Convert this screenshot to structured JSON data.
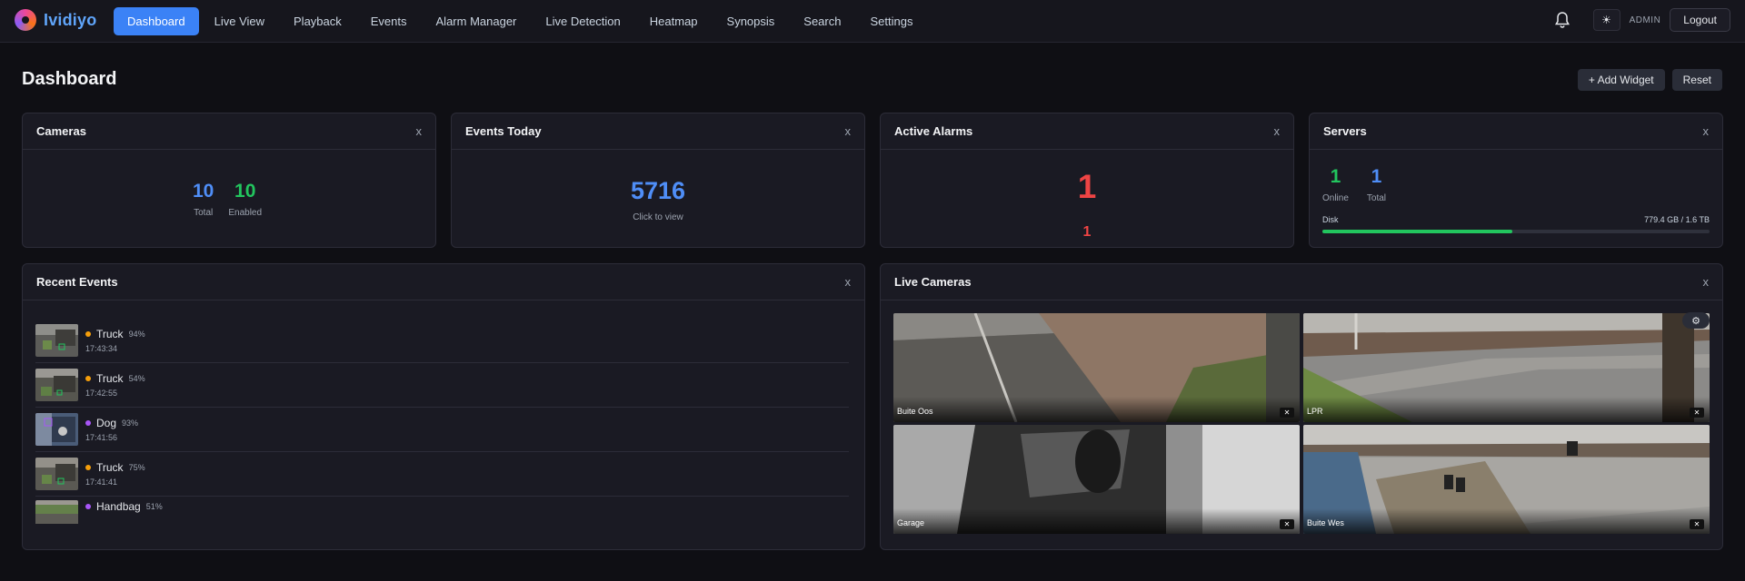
{
  "app": {
    "name": "Ividiyo"
  },
  "nav": {
    "items": [
      {
        "label": "Dashboard",
        "active": true
      },
      {
        "label": "Live View"
      },
      {
        "label": "Playback"
      },
      {
        "label": "Events"
      },
      {
        "label": "Alarm Manager"
      },
      {
        "label": "Live Detection"
      },
      {
        "label": "Heatmap"
      },
      {
        "label": "Synopsis"
      },
      {
        "label": "Search"
      },
      {
        "label": "Settings"
      }
    ],
    "theme_icon": "☀",
    "user": "ADMIN",
    "logout": "Logout"
  },
  "page": {
    "title": "Dashboard",
    "add_widget": "+ Add Widget",
    "reset": "Reset"
  },
  "widgets": {
    "close": "x",
    "cameras": {
      "title": "Cameras",
      "total": "10",
      "total_label": "Total",
      "enabled": "10",
      "enabled_label": "Enabled"
    },
    "events_today": {
      "title": "Events Today",
      "count": "5716",
      "hint": "Click to view"
    },
    "active_alarms": {
      "title": "Active Alarms",
      "count": "1",
      "sub_count": "1"
    },
    "servers": {
      "title": "Servers",
      "online": "1",
      "online_label": "Online",
      "total": "1",
      "total_label": "Total",
      "disk_label": "Disk",
      "disk_value": "779.4 GB / 1.6 TB",
      "disk_fraction": 0.49
    },
    "recent_events": {
      "title": "Recent Events",
      "items": [
        {
          "label": "Truck",
          "conf": "94%",
          "time": "17:43:34",
          "color": "#f59e0b"
        },
        {
          "label": "Truck",
          "conf": "54%",
          "time": "17:42:55",
          "color": "#f59e0b"
        },
        {
          "label": "Dog",
          "conf": "93%",
          "time": "17:41:56",
          "color": "#a855f7"
        },
        {
          "label": "Truck",
          "conf": "75%",
          "time": "17:41:41",
          "color": "#f59e0b"
        },
        {
          "label": "Handbag",
          "conf": "51%",
          "time": "",
          "color": "#a855f7"
        }
      ]
    },
    "live_cameras": {
      "title": "Live Cameras",
      "gear_icon": "⚙",
      "close_icon": "✕",
      "feeds": [
        {
          "name": "Buite Oos"
        },
        {
          "name": "LPR"
        },
        {
          "name": "Garage"
        },
        {
          "name": "Buite Wes"
        }
      ]
    }
  },
  "colors": {
    "accent": "#3b82f6",
    "green": "#22c55e",
    "red": "#ef4444"
  }
}
